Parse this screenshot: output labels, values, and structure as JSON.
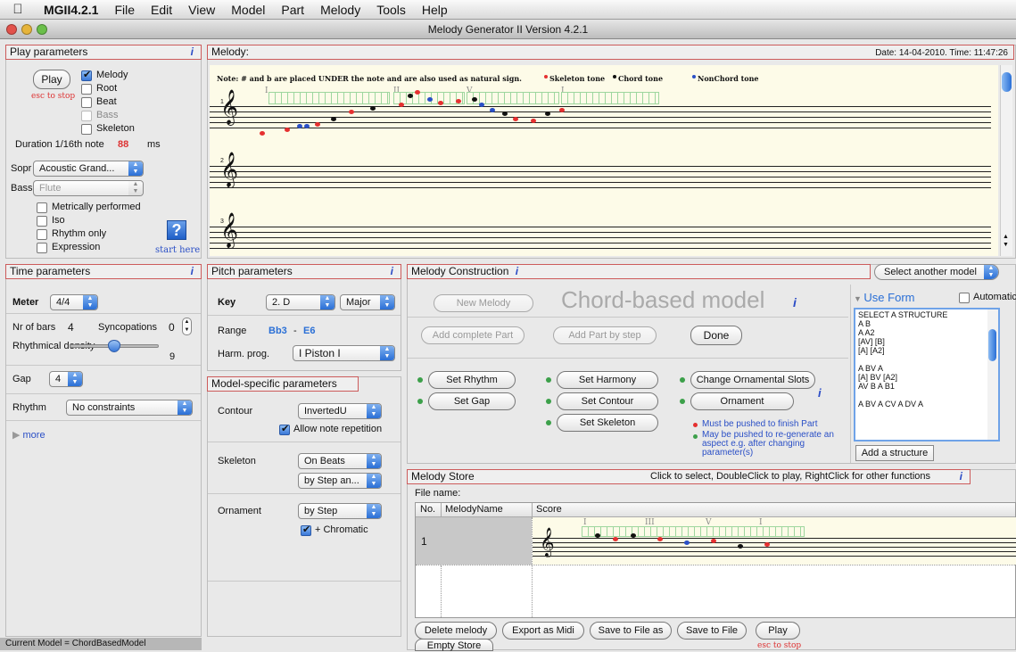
{
  "menubar": {
    "app": "MGII4.2.1",
    "items": [
      "File",
      "Edit",
      "View",
      "Model",
      "Part",
      "Melody",
      "Tools",
      "Help"
    ]
  },
  "window_title": "Melody Generator II Version 4.2.1",
  "play_params": {
    "header": "Play parameters",
    "info": "i",
    "play_label": "Play",
    "esc_label": "esc to stop",
    "checkboxes": [
      {
        "label": "Melody",
        "checked": true,
        "disabled": false
      },
      {
        "label": "Root",
        "checked": false,
        "disabled": false
      },
      {
        "label": "Beat",
        "checked": false,
        "disabled": false
      },
      {
        "label": "Bass",
        "checked": false,
        "disabled": true
      },
      {
        "label": "Skeleton",
        "checked": false,
        "disabled": false
      }
    ],
    "duration_label": "Duration 1/16th note",
    "duration_value": "88",
    "duration_unit": "ms",
    "sopr_label": "Sopr",
    "sopr_value": "Acoustic Grand...",
    "bass_label": "Bass",
    "bass_value": "Flute",
    "options": [
      "Metrically performed",
      "Iso",
      "Rhythm only",
      "Expression"
    ],
    "help_glyph": "?",
    "start_here": "start here"
  },
  "melody": {
    "header": "Melody:",
    "date": "Date: 14-04-2010. Time: 11:47:26",
    "note_text": "Note: # and b are placed UNDER the note and are also used as natural sign.",
    "legend": [
      {
        "label": "Skeleton tone",
        "color": "#e53030"
      },
      {
        "label": "Chord tone",
        "color": "#111111"
      },
      {
        "label": "NonChord tone",
        "color": "#2a4fc6"
      }
    ],
    "staff_numbers": [
      "1",
      "2",
      "3"
    ],
    "roman": [
      "I",
      "II",
      "V",
      "I"
    ]
  },
  "time_params": {
    "header": "Time parameters",
    "info": "i",
    "meter_label": "Meter",
    "meter_value": "4/4",
    "bars_label": "Nr of bars",
    "bars_value": "4",
    "sync_label": "Syncopations",
    "sync_value": "0",
    "density_label": "Rhythmical density",
    "density_value": "9",
    "density_level": 0.5,
    "gap_label": "Gap",
    "gap_value": "4",
    "rhythm_label": "Rhythm",
    "rhythm_value": "No constraints",
    "more_label": "more"
  },
  "pitch_params": {
    "header": "Pitch parameters",
    "info": "i",
    "key_label": "Key",
    "key_value": "2. D",
    "mode_value": "Major",
    "range_label": "Range",
    "range_low": "Bb3",
    "range_sep": "-",
    "range_high": "E6",
    "harm_label": "Harm. prog.",
    "harm_value": "I Piston I"
  },
  "model_params": {
    "header": "Model-specific parameters",
    "contour_label": "Contour",
    "contour_value": "InvertedU",
    "allow_label": "Allow note repetition",
    "skeleton_label": "Skeleton",
    "skeleton_value1": "On Beats",
    "skeleton_value2": "by Step an...",
    "ornament_label": "Ornament",
    "ornament_value": "by Step",
    "chromatic_label": "+ Chromatic"
  },
  "construction": {
    "header": "Melody Construction",
    "info": "i",
    "select_model": "Select another model",
    "new_melody": "New Melody",
    "model_title": "Chord-based model",
    "model_info": "i",
    "add_complete": "Add complete Part",
    "add_step": "Add Part by step",
    "done": "Done",
    "set_rhythm": "Set Rhythm",
    "set_gap": "Set Gap",
    "set_harmony": "Set Harmony",
    "set_contour": "Set Contour",
    "set_skeleton": "Set Skeleton",
    "change_orn": "Change Ornamental Slots",
    "ornament": "Ornament",
    "orn_info": "i",
    "note1": "Must be pushed to finish Part",
    "note2": "May be pushed to re-generate an aspect e.g. after changing parameter(s)",
    "use_form": "Use Form",
    "automatic": "Automatic",
    "structures": [
      "SELECT A STRUCTURE",
      "A B",
      "A A2",
      "[AV] [B]",
      "[A] [A2]",
      "",
      "A BV A",
      "[A] BV [A2]",
      "AV B A B1",
      "",
      "A BV A CV A DV A"
    ],
    "add_structure": "Add a structure"
  },
  "store": {
    "header": "Melody Store",
    "hint": "Click to select, DoubleClick to play, RightClick for other functions",
    "info": "i",
    "file_name": "File name:",
    "columns": [
      "No.",
      "MelodyName",
      "Score"
    ],
    "rows": [
      {
        "no": "1",
        "name": ""
      }
    ],
    "roman": [
      "I",
      "III",
      "V",
      "I"
    ],
    "buttons": [
      "Delete melody",
      "Export as Midi",
      "Save to File as",
      "Save to File",
      "Play"
    ],
    "empty_store": "Empty Store",
    "esc_label": "esc to stop"
  },
  "status": "Current Model = ChordBasedModel",
  "colors": {
    "skeleton": "#e53030",
    "chord": "#111111",
    "nonchord": "#2a4fc6",
    "accent": "#2a6fd6",
    "panel_border": "#cc5b5b"
  }
}
